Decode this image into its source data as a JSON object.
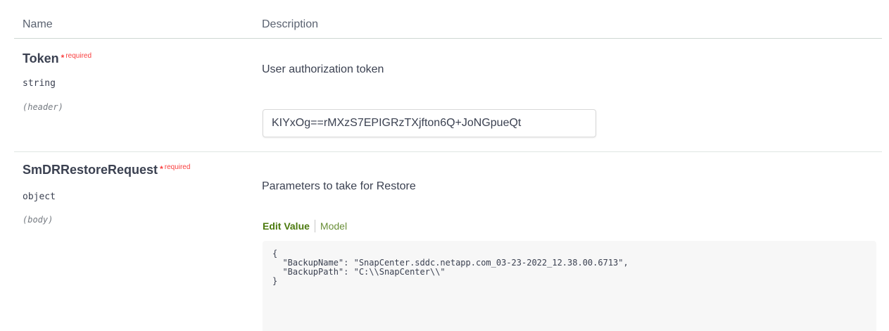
{
  "table": {
    "headers": {
      "name": "Name",
      "description": "Description"
    }
  },
  "params": {
    "token": {
      "name": "Token",
      "star": "*",
      "required": "required",
      "type": "string",
      "in": "(header)",
      "description": "User authorization token",
      "value": "KIYxOg==rMXzS7EPIGRzTXjfton6Q+JoNGpueQt"
    },
    "request": {
      "name": "SmDRRestoreRequest",
      "star": "*",
      "required": "required",
      "type": "object",
      "in": "(body)",
      "description": "Parameters to take for Restore",
      "tabs": {
        "edit_value": "Edit Value",
        "model": "Model"
      },
      "body_value": "{\n  \"BackupName\": \"SnapCenter.sddc.netapp.com_03-23-2022_12.38.00.6713\",\n  \"BackupPath\": \"C:\\\\SnapCenter\\\\\"\n}"
    }
  },
  "colors": {
    "required": "#f93e3e",
    "tab_active": "#4c7a0e",
    "text": "#3b4151"
  }
}
